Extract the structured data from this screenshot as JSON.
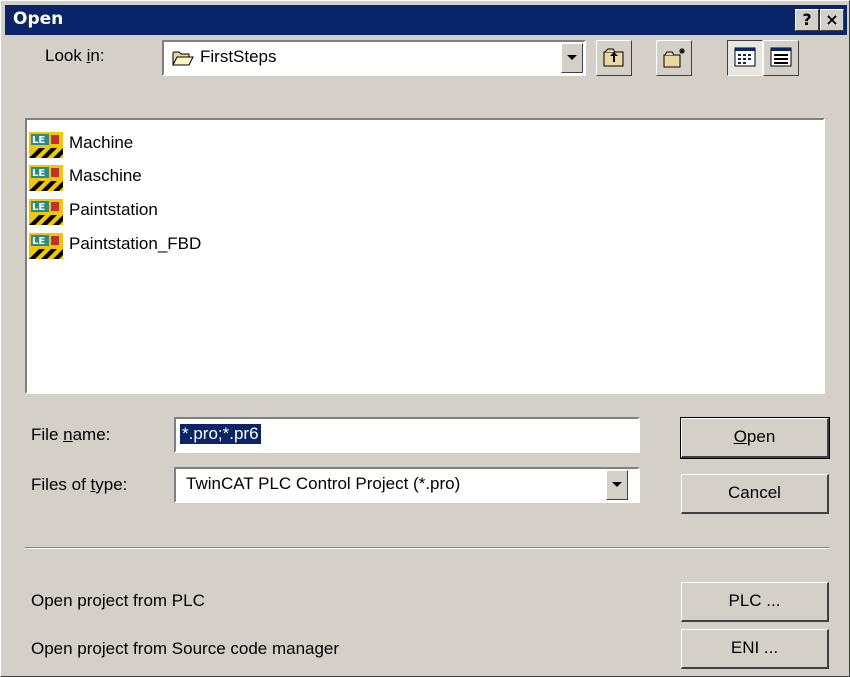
{
  "window": {
    "title": "Open",
    "help_button": "?",
    "close_button": "×"
  },
  "look_in": {
    "label_pre": "Look ",
    "label_u": "i",
    "label_post": "n:",
    "value": "FirstSteps"
  },
  "toolbar": {
    "up_folder": "up-one-level",
    "new_folder": "create-new-folder",
    "list_view": "list-view",
    "details_view": "details-view"
  },
  "files": [
    {
      "name": "Machine",
      "icon": "twincat-project-icon"
    },
    {
      "name": "Maschine",
      "icon": "twincat-project-icon"
    },
    {
      "name": "Paintstation",
      "icon": "twincat-project-icon"
    },
    {
      "name": "Paintstation_FBD",
      "icon": "twincat-project-icon"
    }
  ],
  "file_name": {
    "label_pre": "File ",
    "label_u": "n",
    "label_post": "ame:",
    "value": "*.pro;*.pr6"
  },
  "file_type": {
    "label_pre": "Files of ",
    "label_u": "t",
    "label_post": "ype:",
    "value": "TwinCAT PLC Control Project (*.pro)"
  },
  "buttons": {
    "open_u": "O",
    "open_rest": "pen",
    "cancel": "Cancel",
    "plc": "PLC ...",
    "eni": "ENI ..."
  },
  "extra": {
    "from_plc": "Open project from PLC",
    "from_scm": "Open project from Source code manager"
  },
  "colors": {
    "titlebar": "#0a246a",
    "face": "#d4d0c8",
    "selection": "#0a246a"
  }
}
